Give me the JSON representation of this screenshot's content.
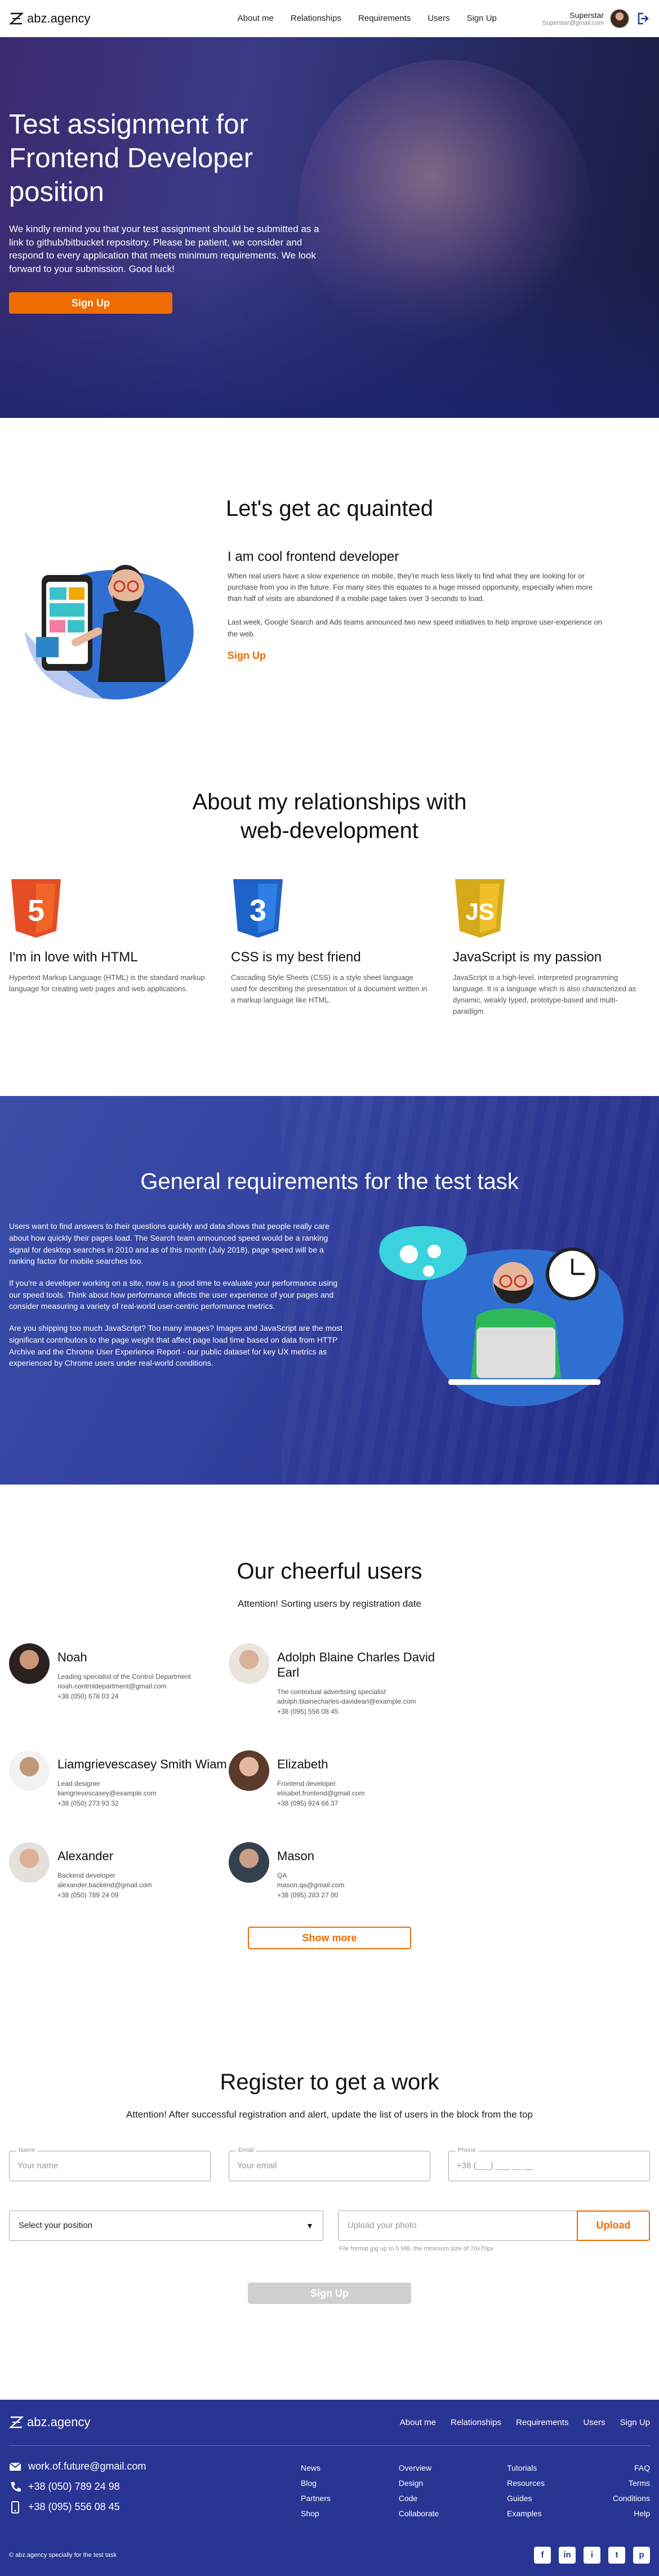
{
  "header": {
    "logo_text": "abz.agency",
    "nav": [
      "About me",
      "Relationships",
      "Requirements",
      "Users",
      "Sign Up"
    ],
    "user_name": "Superstar",
    "user_email": "Superstar@gmail.com"
  },
  "hero": {
    "title": "Test assignment for Frontend Developer position",
    "text": "We kindly remind you that your test assignment should be submitted as a link to github/bitbucket repository. Please be patient, we consider and respond to every application that meets minimum requirements. We look forward to your submission. Good luck!",
    "button": "Sign Up"
  },
  "acquainted": {
    "title": "Let's get ac quainted",
    "heading": "I am cool frontend developer",
    "p1": "When real users have a slow experience on mobile, they're much less likely to find what they are looking for or purchase from you in the future. For many sites this equates to a huge missed opportunity, especially when more than half of visits are abandoned if a mobile page takes over 3 seconds to load.",
    "p2": "Last week, Google Search and Ads teams announced two new speed initiatives to help improve user-experience on the web.",
    "link": "Sign Up"
  },
  "about": {
    "title": "About my relationships with web-development",
    "cards": [
      {
        "badge": "5",
        "title": "I'm in love with HTML",
        "text": "Hypertext Markup Language (HTML) is the standard markup language for creating web pages and web applications.",
        "color": "#e44d26"
      },
      {
        "badge": "3",
        "title": "CSS is my best friend",
        "text": "Cascading Style Sheets (CSS) is a style sheet language used for describing the presentation of a document written in a markup language like HTML.",
        "color": "#1f62c6"
      },
      {
        "badge": "JS",
        "title": "JavaScript is my passion",
        "text": "JavaScript is a high-level, interpreted programming language. It is a language which is also characterized as dynamic, weakly typed, prototype-based and multi-paradigm.",
        "color": "#e5b522"
      }
    ]
  },
  "requirements": {
    "title": "General requirements for the test task",
    "p1": "Users want to find answers to their questions quickly and data shows that people really care about how quickly their pages load. The Search team announced speed would be a ranking signal for desktop searches in 2010 and as of this month (July 2018), page speed will be a ranking factor for mobile searches too.",
    "p2": "If you're a developer working on a site, now is a good time to evaluate your performance using our speed tools. Think about how performance affects the user experience of your pages and consider measuring a variety of real-world user-centric performance metrics.",
    "p3": "Are you shipping too much JavaScript? Too many images? Images and JavaScript are the most significant contributors to the page weight that affect page load time based on data from HTTP Archive and the Chrome User Experience Report - our public dataset for key UX metrics as experienced by Chrome users under real-world conditions."
  },
  "users": {
    "title": "Our cheerful users",
    "subtitle": "Attention! Sorting users by registration date",
    "list": [
      {
        "name": "Noah",
        "position": "Leading specialist of the Control Department",
        "email": "noah.controldepartment@gmail.com",
        "phone": "+38 (050) 678 03 24"
      },
      {
        "name": "Adolph Blaine Charles David Earl",
        "position": "The contextual advertising specialist",
        "email": "adolph.blainecharles-davidearl@example.com",
        "phone": "+38 (095) 556 08 45"
      },
      {
        "name": "Liamgrievescasey Smith Wiam",
        "position": "Lead designer",
        "email": "liamgrievescasey@example.com",
        "phone": "+38 (050) 273 93 32"
      },
      {
        "name": "Elizabeth",
        "position": "Frontend developer",
        "email": "elisabet.frontend@gmail.com",
        "phone": "+38 (095) 924 66 37"
      },
      {
        "name": "Alexander",
        "position": "Backend developer",
        "email": "alexander.backend@gmail.com",
        "phone": "+38 (050) 789 24 09"
      },
      {
        "name": "Mason",
        "position": "QA",
        "email": "mason.qa@gmail.com",
        "phone": "+38 (095) 283 27 00"
      }
    ],
    "button": "Show more"
  },
  "register": {
    "title": "Register to get a work",
    "subtitle": "Attention! After successful registration and alert, update the list of users in the block from the top",
    "name_label": "Name",
    "name_placeholder": "Your name",
    "email_label": "Email",
    "email_placeholder": "Your email",
    "phone_label": "Phone",
    "phone_placeholder": "+38 (___) ___ __ __",
    "select": "Select your position",
    "upload_placeholder": "Upload your photo",
    "upload_button": "Upload",
    "hint": "File format jpg up to 5 MB, the minimum size of 70x70px",
    "submit": "Sign Up"
  },
  "footer": {
    "logo_text": "abz.agency",
    "nav": [
      "About me",
      "Relationships",
      "Requirements",
      "Users",
      "Sign Up"
    ],
    "email": "work.of.future@gmail.com",
    "phone1": "+38 (050) 789 24 98",
    "phone2": "+38 (095) 556 08 45",
    "cols": [
      [
        "News",
        "Blog",
        "Partners",
        "Shop"
      ],
      [
        "Overview",
        "Design",
        "Code",
        "Collaborate"
      ],
      [
        "Tutorials",
        "Resources",
        "Guides",
        "Examples"
      ],
      [
        "FAQ",
        "Terms",
        "Conditions",
        "Help"
      ]
    ],
    "copyright": "© abz.agency specially for the test task",
    "social": [
      "f",
      "in",
      "i",
      "t",
      "p"
    ]
  }
}
